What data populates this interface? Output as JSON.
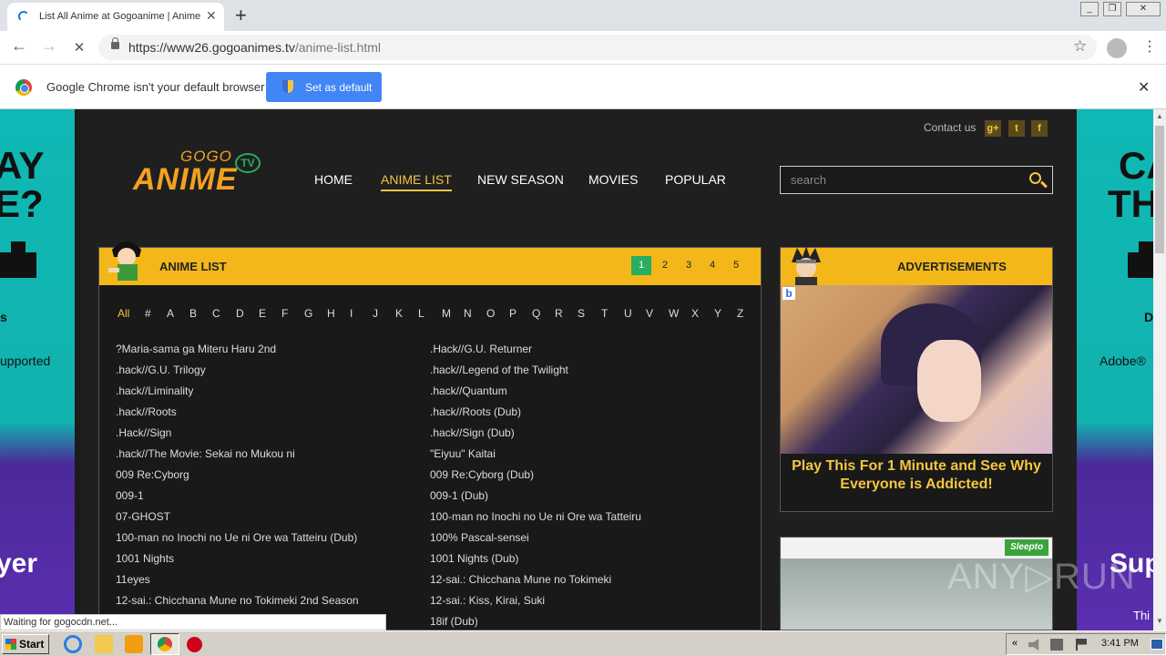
{
  "browser": {
    "tab_title": "List All Anime at Gogoanime | Anime",
    "tab_close": "✕",
    "new_tab": "+",
    "back": "←",
    "forward": "→",
    "reload": "✕",
    "url_host": "https://www26.gogoanimes.tv",
    "url_path": "/anime-list.html",
    "star": "☆",
    "menu": "⋮",
    "window_buttons": {
      "minimize": "_",
      "restore": "❐",
      "close": "✕"
    }
  },
  "infobar": {
    "text": "Google Chrome isn't your default browser",
    "button": "Set as default",
    "close": "✕"
  },
  "site": {
    "contact": "Contact us",
    "social": [
      "g+",
      "t",
      "f"
    ],
    "logo_top": "GOGO",
    "logo_main": "ANIME",
    "logo_tv": "TV",
    "nav": [
      "HOME",
      "ANIME LIST",
      "NEW SEASON",
      "MOVIES",
      "POPULAR"
    ],
    "search_placeholder": "search"
  },
  "left_ad": {
    "line1": "AY",
    "line2": "E?",
    "line3": "s",
    "line4": "upported",
    "line5": "yer"
  },
  "right_ad": {
    "line1": "CA",
    "line2": "TH",
    "line3": "D",
    "line4": "Adobe®",
    "line5": "Sup",
    "line6": "Thi"
  },
  "list": {
    "title": "ANIME LIST",
    "pages": [
      "1",
      "2",
      "3",
      "4",
      "5"
    ],
    "letters": [
      "All",
      "#",
      "A",
      "B",
      "C",
      "D",
      "E",
      "F",
      "G",
      "H",
      "I",
      "J",
      "K",
      "L",
      "M",
      "N",
      "O",
      "P",
      "Q",
      "R",
      "S",
      "T",
      "U",
      "V",
      "W",
      "X",
      "Y",
      "Z"
    ],
    "left_col": [
      "?Maria-sama ga Miteru Haru 2nd",
      ".hack//G.U. Trilogy",
      ".hack//Liminality",
      ".hack//Roots",
      ".Hack//Sign",
      ".hack//The Movie: Sekai no Mukou ni",
      "009 Re:Cyborg",
      "009-1",
      "07-GHOST",
      "100-man no Inochi no Ue ni Ore wa Tatteiru (Dub)",
      "1001 Nights",
      "11eyes",
      "12-sai.: Chicchana Mune no Tokimeki 2nd Season"
    ],
    "right_col": [
      ".Hack//G.U. Returner",
      ".hack//Legend of the Twilight",
      ".hack//Quantum",
      ".hack//Roots (Dub)",
      ".hack//Sign (Dub)",
      "\"Eiyuu\" Kaitai",
      "009 Re:Cyborg (Dub)",
      "009-1 (Dub)",
      "100-man no Inochi no Ue ni Ore wa Tatteiru",
      "100% Pascal-sensei",
      "1001 Nights (Dub)",
      "12-sai.: Chicchana Mune no Tokimeki",
      "12-sai.: Kiss, Kirai, Suki",
      "18if (Dub)"
    ]
  },
  "ads": {
    "title": "ADVERTISEMENTS",
    "copy": "Play This For 1 Minute and See Why Everyone is Addicted!",
    "badge_b": "b",
    "ad2_badge": "Sleepto"
  },
  "watermark": "ANY▷RUN",
  "status": "Waiting for gogocdn.net...",
  "taskbar": {
    "start": "Start",
    "clock": "3:41 PM"
  },
  "colors": {
    "accent": "#f3b71a",
    "page_bg": "#1f1f1f",
    "active_page": "#27ae60",
    "chrome_blue": "#4285f4"
  }
}
